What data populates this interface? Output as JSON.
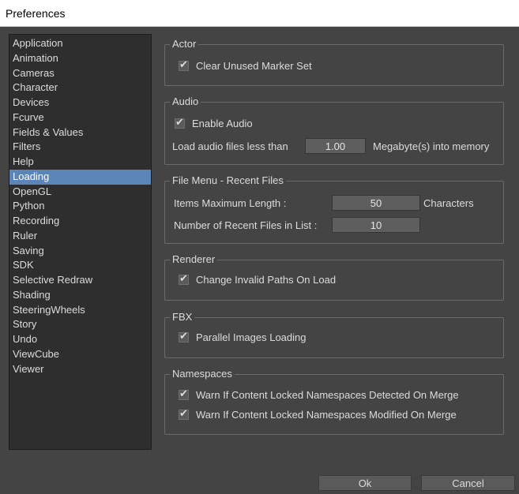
{
  "window": {
    "title": "Preferences"
  },
  "categories": [
    "Application",
    "Animation",
    "Cameras",
    "Character",
    "Devices",
    "Fcurve",
    "Fields & Values",
    "Filters",
    "Help",
    "Loading",
    "OpenGL",
    "Python",
    "Recording",
    "Ruler",
    "Saving",
    "SDK",
    "Selective Redraw",
    "Shading",
    "SteeringWheels",
    "Story",
    "Undo",
    "ViewCube",
    "Viewer"
  ],
  "selected_category": "Loading",
  "actor": {
    "title": "Actor",
    "clear_unused_marker_set": {
      "label": "Clear Unused Marker Set",
      "checked": true
    }
  },
  "audio": {
    "title": "Audio",
    "enable_audio": {
      "label": "Enable Audio",
      "checked": true
    },
    "load_label": "Load audio files less than",
    "load_value": "1.00",
    "load_unit": "Megabyte(s) into memory"
  },
  "file_menu": {
    "title": "File Menu - Recent Files",
    "max_length_label": "Items Maximum Length :",
    "max_length_value": "50",
    "max_length_unit": "Characters",
    "recent_count_label": "Number of Recent Files in List :",
    "recent_count_value": "10"
  },
  "renderer": {
    "title": "Renderer",
    "change_invalid_paths": {
      "label": "Change Invalid Paths On Load",
      "checked": true
    }
  },
  "fbx": {
    "title": "FBX",
    "parallel_images": {
      "label": "Parallel Images Loading",
      "checked": true
    }
  },
  "namespaces": {
    "title": "Namespaces",
    "warn_detected": {
      "label": "Warn If Content Locked Namespaces Detected On Merge",
      "checked": true
    },
    "warn_modified": {
      "label": "Warn If Content Locked Namespaces Modified On Merge",
      "checked": true
    }
  },
  "buttons": {
    "ok": "Ok",
    "cancel": "Cancel"
  },
  "check_glyph": "✔"
}
